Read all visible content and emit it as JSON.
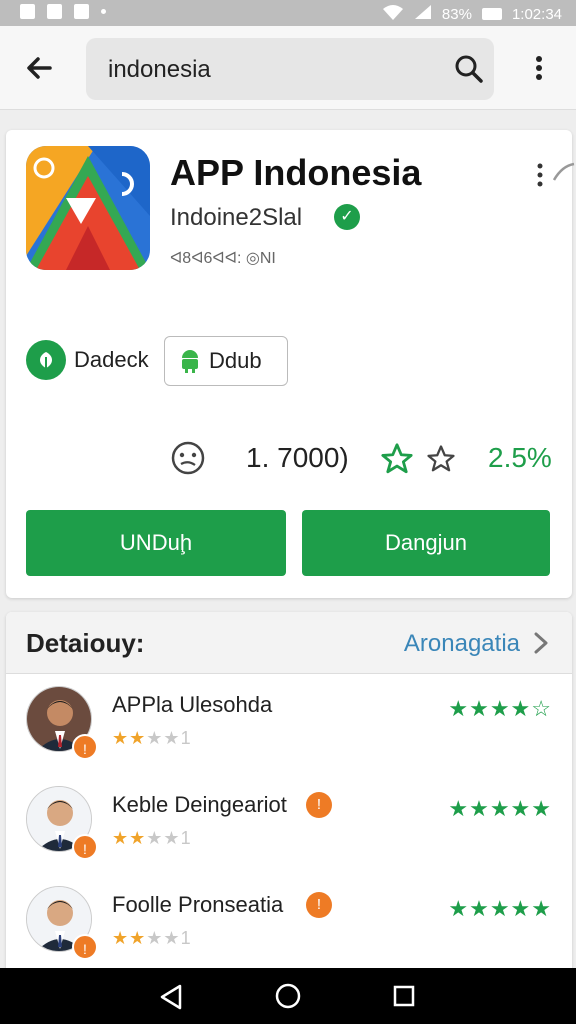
{
  "status_bar": {
    "time": "1:02:34",
    "battery": "83%"
  },
  "search": {
    "query": "indonesia"
  },
  "app": {
    "title": "APP Indonesia",
    "developer": "Indoine2Slal",
    "meta": "ᐊ8ᐊ6ᐊᐊ: ◎NI",
    "badge_verify_label": "Dadeck",
    "badge_android_label": "Ddub",
    "rating_count": "1. 7000)",
    "rating_percent": "2.5%",
    "button_primary": "UNDuḩ",
    "button_secondary": "Dangjun"
  },
  "details": {
    "title": "Detaiouy:",
    "link": "Aronagatia",
    "reviews": [
      {
        "name": "APPla Ulesohda",
        "stars_filled": 2,
        "stars_suffix": "1",
        "right_rating": "★★★★☆",
        "name_badge": false
      },
      {
        "name": "Keble Deingeariot",
        "stars_filled": 2,
        "stars_suffix": "1",
        "right_rating": "★★★★★",
        "name_badge": true
      },
      {
        "name": "Foolle Pronseatia",
        "stars_filled": 2,
        "stars_suffix": "1",
        "right_rating": "★★★★★",
        "name_badge": true
      }
    ]
  },
  "colors": {
    "accent": "#1e9e4a",
    "link": "#3a86b8",
    "badge_orange": "#ee7b25",
    "star": "#f0a32a"
  },
  "icons": [
    "back-arrow-icon",
    "search-icon",
    "more-vert-icon",
    "verified-icon",
    "leaf-icon",
    "android-icon",
    "smiley-icon",
    "star-outline-icon",
    "chevron-right-icon"
  ]
}
